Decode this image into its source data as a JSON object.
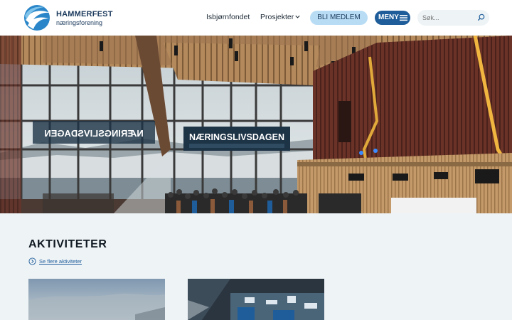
{
  "header": {
    "logo_name": "HAMMERFEST",
    "logo_sub": "næringsforening",
    "nav": [
      {
        "label": "Isbjørnfondet"
      },
      {
        "label": "Prosjekter"
      }
    ],
    "member_button": "BLI MEDLEM",
    "menu_button": "MENY",
    "search_placeholder": "Søk..."
  },
  "hero": {
    "banner_text": "NÆRINGSLIVSDAGEN",
    "reflection_text": "NÆRINGSLIVSDAGEN"
  },
  "activities": {
    "title": "AKTIVITETER",
    "more_link": "Se flere aktiviteter"
  },
  "colors": {
    "brand_dark": "#1f5d9a",
    "brand_light": "#b9dcf5",
    "section_bg": "#eef3f6"
  }
}
